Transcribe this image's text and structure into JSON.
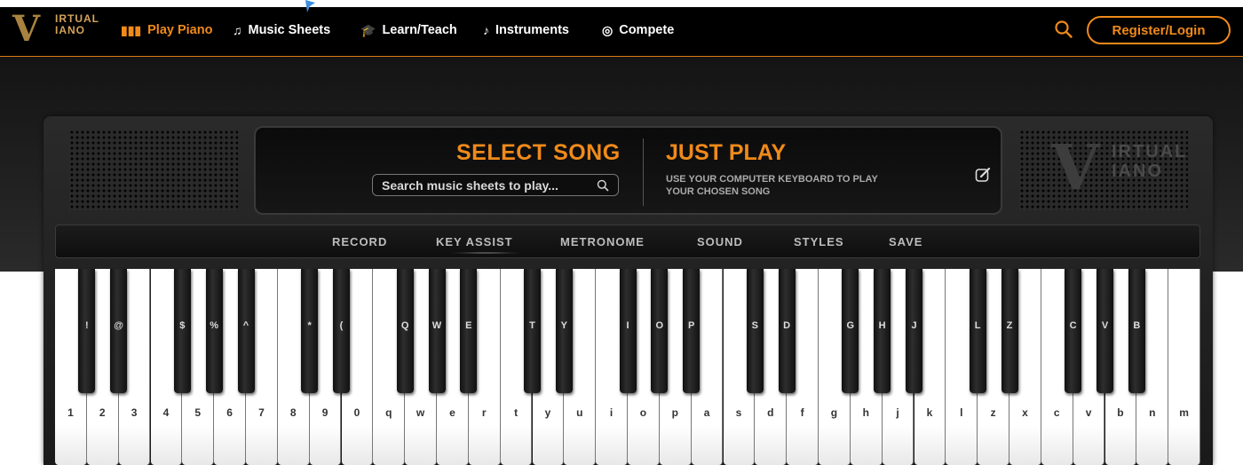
{
  "nav": {
    "logo_line1": "IRTUAL",
    "logo_line2": "IANO",
    "items": [
      {
        "label": "Play Piano",
        "icon": "piano-keys-icon",
        "active": true
      },
      {
        "label": "Music Sheets",
        "icon": "music-notes-icon",
        "active": false
      },
      {
        "label": "Learn/Teach",
        "icon": "graduation-cap-icon",
        "active": false
      },
      {
        "label": "Instruments",
        "icon": "guitar-icon",
        "active": false
      },
      {
        "label": "Compete",
        "icon": "target-icon",
        "active": false
      }
    ],
    "register_label": "Register/Login",
    "accent_color": "#f08a1a"
  },
  "display": {
    "select_title": "SELECT SONG",
    "search_placeholder": "Search music sheets to play...",
    "play_title": "JUST PLAY",
    "play_sub_line1": "USE YOUR COMPUTER KEYBOARD TO PLAY",
    "play_sub_line2": "YOUR CHOSEN SONG"
  },
  "brand": {
    "line1": "IRTUAL",
    "line2": "IANO"
  },
  "toolbar": {
    "items": [
      "RECORD",
      "KEY ASSIST",
      "METRONOME",
      "SOUND",
      "STYLES",
      "SAVE"
    ]
  },
  "keyboard": {
    "white_keys": [
      "1",
      "2",
      "3",
      "4",
      "5",
      "6",
      "7",
      "8",
      "9",
      "0",
      "q",
      "w",
      "e",
      "r",
      "t",
      "y",
      "u",
      "i",
      "o",
      "p",
      "a",
      "s",
      "d",
      "f",
      "g",
      "h",
      "j",
      "k",
      "l",
      "z",
      "x",
      "c",
      "v",
      "b",
      "n",
      "m"
    ],
    "black_keys": [
      "!",
      "@",
      "$",
      "%",
      "^",
      "*",
      "(",
      "Q",
      "W",
      "E",
      "T",
      "Y",
      "I",
      "O",
      "P",
      "S",
      "D",
      "G",
      "H",
      "J",
      "L",
      "Z",
      "C",
      "V",
      "B"
    ]
  }
}
